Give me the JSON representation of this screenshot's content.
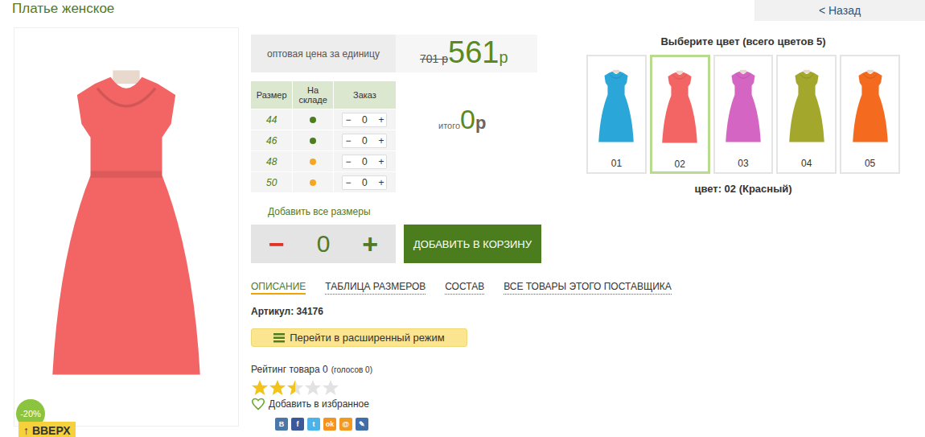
{
  "page": {
    "title": "Платье женское",
    "back_button": "< Назад"
  },
  "photo": {
    "discount_badge": "-20%",
    "up_button": "↑ ВВЕРХ"
  },
  "price": {
    "label": "оптовая цена за единицу",
    "old": "701 р",
    "current": "561",
    "currency": "р"
  },
  "sizes": {
    "columns": [
      "Размер",
      "На складе",
      "Заказ"
    ],
    "minus": "−",
    "plus": "+",
    "rows": [
      {
        "size": "44",
        "qty": "0",
        "color": "#4e7d1e"
      },
      {
        "size": "46",
        "qty": "0",
        "color": "#4e7d1e"
      },
      {
        "size": "48",
        "qty": "0",
        "color": "#f5a623"
      },
      {
        "size": "50",
        "qty": "0",
        "color": "#f5a623"
      }
    ]
  },
  "total": {
    "label": "итого",
    "value": "0",
    "currency": "р"
  },
  "add_all": "Добавить все размеры",
  "quantity": {
    "minus": "−",
    "value": "0",
    "plus": "+"
  },
  "cart_button": "ДОБАВИТЬ В КОРЗИНУ",
  "tabs": [
    {
      "label": "ОПИСАНИЕ",
      "selected": true
    },
    {
      "label": "ТАБЛИЦА РАЗМЕРОВ",
      "selected": false
    },
    {
      "label": "СОСТАВ",
      "selected": false
    },
    {
      "label": "ВСЕ ТОВАРЫ ЭТОГО ПОСТАВЩИКА",
      "selected": false
    }
  ],
  "article": "Артикул: 34176",
  "extended_mode_button": "Перейти в расширенный режим",
  "rating": {
    "label": "Рейтинг товара 0",
    "votes": "(голосов 0)",
    "stars": 2.5
  },
  "favorite": "Добавить в избранное",
  "share": [
    {
      "glyph": "В",
      "color": "#4a76a8"
    },
    {
      "glyph": "f",
      "color": "#3b5998"
    },
    {
      "glyph": "t",
      "color": "#4bb3e8"
    },
    {
      "glyph": "ok",
      "color": "#f4931f"
    },
    {
      "glyph": "@",
      "color": "#f29a1f"
    },
    {
      "glyph": "✎",
      "color": "#3f6ea8"
    }
  ],
  "colors": {
    "title": "Выберите цвет (всего цветов 5)",
    "items": [
      {
        "label": "01",
        "color": "#2aa7d8",
        "selected": false
      },
      {
        "label": "02",
        "color": "#f36464",
        "selected": true
      },
      {
        "label": "03",
        "color": "#d465c2",
        "selected": false
      },
      {
        "label": "04",
        "color": "#a3a82c",
        "selected": false
      },
      {
        "label": "05",
        "color": "#f46a1e",
        "selected": false
      }
    ],
    "caption": "цвет: 02 (Красный)"
  }
}
